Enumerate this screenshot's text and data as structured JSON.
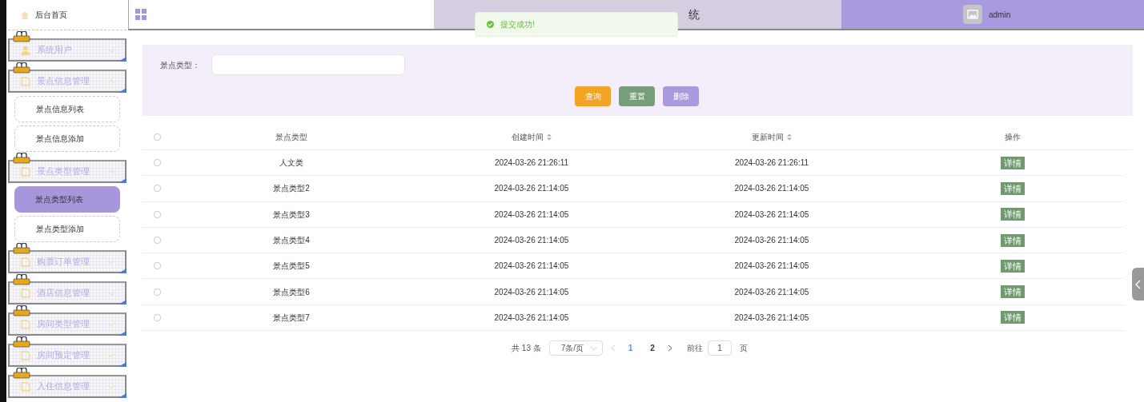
{
  "sidebar": {
    "home": "后台首页",
    "menus": [
      {
        "label": "系统用户",
        "expanded": false
      },
      {
        "label": "景点信息管理",
        "expanded": true,
        "children": [
          {
            "label": "景点信息列表",
            "selected": false
          },
          {
            "label": "景点信息添加",
            "selected": false
          }
        ]
      },
      {
        "label": "景点类型管理",
        "expanded": true,
        "children": [
          {
            "label": "景点类型列表",
            "selected": true
          },
          {
            "label": "景点类型添加",
            "selected": false
          }
        ]
      },
      {
        "label": "购票订单管理",
        "expanded": false
      },
      {
        "label": "酒店信息管理",
        "expanded": false
      },
      {
        "label": "房间类型管理",
        "expanded": false
      },
      {
        "label": "房间预定管理",
        "expanded": false
      },
      {
        "label": "入住信息管理",
        "expanded": false
      }
    ]
  },
  "header": {
    "title": "统",
    "user": "admin"
  },
  "toast": {
    "message": "提交成功!"
  },
  "search": {
    "label": "景点类型：",
    "buttons": [
      "查询",
      "重置",
      "删除"
    ]
  },
  "table": {
    "select_all_checked": false,
    "columns": [
      "景点类型",
      "创建时间",
      "更新时间",
      "操作"
    ],
    "rows": [
      {
        "type": "人文类",
        "created": "2024-03-26 21:26:11",
        "updated": "2024-03-26 21:26:11",
        "action": "详情",
        "checked": false
      },
      {
        "type": "景点类型2",
        "created": "2024-03-26 21:14:05",
        "updated": "2024-03-26 21:14:05",
        "action": "详情",
        "checked": false
      },
      {
        "type": "景点类型3",
        "created": "2024-03-26 21:14:05",
        "updated": "2024-03-26 21:14:05",
        "action": "详情",
        "checked": false
      },
      {
        "type": "景点类型4",
        "created": "2024-03-26 21:14:05",
        "updated": "2024-03-26 21:14:05",
        "action": "详情",
        "checked": false
      },
      {
        "type": "景点类型5",
        "created": "2024-03-26 21:14:05",
        "updated": "2024-03-26 21:14:05",
        "action": "详情",
        "checked": false
      },
      {
        "type": "景点类型6",
        "created": "2024-03-26 21:14:05",
        "updated": "2024-03-26 21:14:05",
        "action": "详情",
        "checked": false
      },
      {
        "type": "景点类型7",
        "created": "2024-03-26 21:14:05",
        "updated": "2024-03-26 21:14:05",
        "action": "详情",
        "checked": false
      }
    ]
  },
  "pagination": {
    "total": "共 13 条",
    "page_size": "7条/页",
    "pages": [
      {
        "label": "1",
        "selected": true
      },
      {
        "label": "2",
        "selected": false
      }
    ],
    "goto_label": "前往",
    "goto_value": "1",
    "goto_suffix": "页"
  }
}
